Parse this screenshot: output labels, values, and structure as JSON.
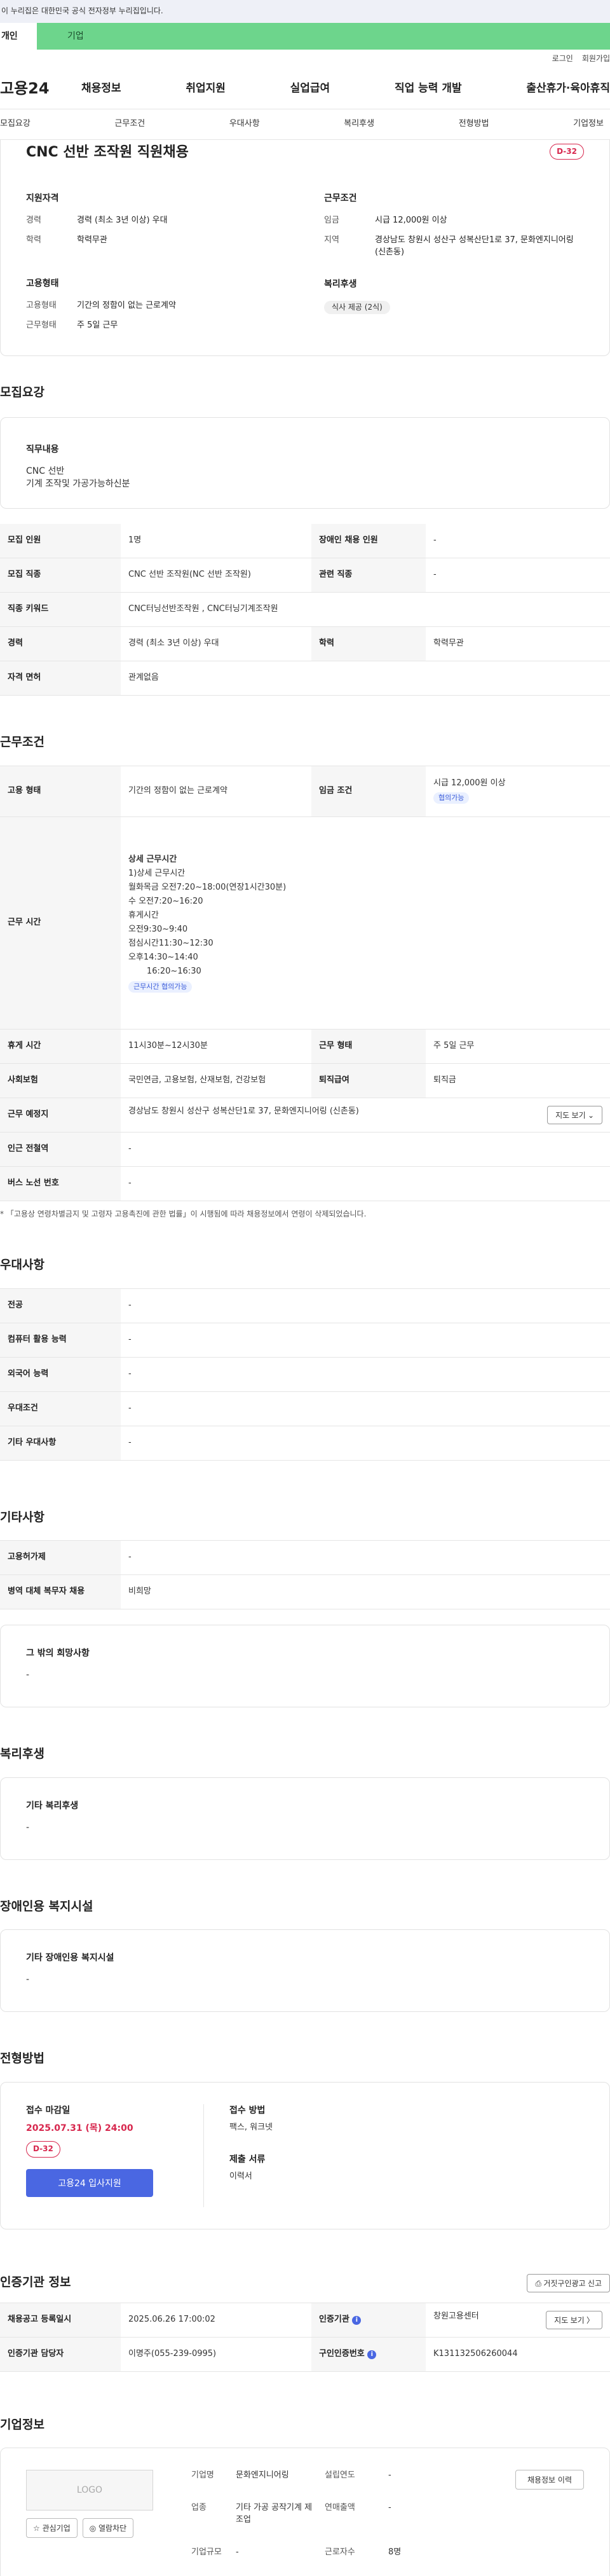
{
  "gov_banner": "이 누리집은 대한민국 공식 전자정부 누리집입니다.",
  "svc_tabs": {
    "personal": "개인",
    "corporate": "기업"
  },
  "util": {
    "login": "로그인",
    "join": "회원가입"
  },
  "logo": "고용24",
  "nav": [
    "채용정보",
    "취업지원",
    "실업급여",
    "직업 능력 개발",
    "출산휴가·육아휴직"
  ],
  "sub_tabs": [
    "모집요강",
    "근무조건",
    "우대사항",
    "복리후생",
    "전형방법",
    "기업정보"
  ],
  "summary": {
    "title": "CNC 선반 조작원 직원채용",
    "dday": "D-32",
    "qual_title": "지원자격",
    "career_k": "경력",
    "career_v": "경력 (최소 3년 이상) 우대",
    "edu_k": "학력",
    "edu_v": "학력무관",
    "emp_title": "고용형태",
    "emptype_k": "고용형태",
    "emptype_v": "기간의 정함이 없는 근로계약",
    "worktype_k": "근무형태",
    "worktype_v": "주 5일 근무",
    "cond_title": "근무조건",
    "wage_k": "임금",
    "wage_v": "시급 12,000원 이상",
    "area_k": "지역",
    "area_v": "경상남도 창원시 성산구 성복산단1로 37, 문화엔지니어링 (신촌동)",
    "welfare_title": "복리후생",
    "welfare_v": "식사 제공 (2식)"
  },
  "recruit": {
    "title": "모집요강",
    "duty_h": "직무내용",
    "duty_1": "CNC 선반",
    "duty_2": "기계 조작및 가공가능하신분",
    "rows": {
      "count_k": "모집 인원",
      "count_v": "1명",
      "disabled_k": "장애인 채용 인원",
      "disabled_v": "-",
      "job_k": "모집 직종",
      "job_v": "CNC 선반 조작원(NC 선반 조작원)",
      "related_k": "관련 직종",
      "related_v": "-",
      "kw_k": "직종 키워드",
      "kw_v": "CNC터닝선반조작원 , CNC터닝기계조작원",
      "career_k": "경력",
      "career_v": "경력 (최소 3년 이상) 우대",
      "edu_k": "학력",
      "edu_v": "학력무관",
      "license_k": "자격 면허",
      "license_v": "관계없음"
    }
  },
  "work": {
    "title": "근무조건",
    "emptype_k": "고용 형태",
    "emptype_v": "기간의 정함이 없는 근로계약",
    "wage_k": "임금 조건",
    "wage_v": "시급 12,000원 이상",
    "wage_chip": "협의가능",
    "hours_k": "근무 시간",
    "hours_lines": [
      "상세 근무시간",
      "1)상세 근무시간",
      "월화목금 오전7:20~18:00(연장1시간30분)",
      "수 오전7:20~16:20",
      "휴게시간",
      "오전9:30~9:40",
      "점심시간11:30~12:30",
      "오후14:30~14:40",
      "       16:20~16:30"
    ],
    "hours_chip": "근무시간 협의가능",
    "break_k": "휴게 시간",
    "break_v": "11시30분~12시30분",
    "form_k": "근무 형태",
    "form_v": "주 5일 근무",
    "insure_k": "사회보험",
    "insure_v": "국민연금, 고용보험, 산재보험, 건강보험",
    "retire_k": "퇴직급여",
    "retire_v": "퇴직금",
    "place_k": "근무 예정지",
    "place_v": "경상남도 창원시 성산구 성복산단1로 37, 문화엔지니어링 (신촌동)",
    "map_btn": "지도 보기 ⌄",
    "subway_k": "인근 전철역",
    "subway_v": "-",
    "bus_k": "버스 노선 번호",
    "bus_v": "-",
    "note": "* 「고용상 연령차별금지 및 고령자 고용촉진에 관한 법률」이 시행됨에 따라 채용정보에서 연령이 삭제되었습니다."
  },
  "pref": {
    "title": "우대사항",
    "major_k": "전공",
    "major_v": "-",
    "pc_k": "컴퓨터 활용 능력",
    "pc_v": "-",
    "lang_k": "외국어 능력",
    "lang_v": "-",
    "cond_k": "우대조건",
    "cond_v": "-",
    "etc_k": "기타 우대사항",
    "etc_v": "-"
  },
  "other": {
    "title": "기타사항",
    "permit_k": "고용허가제",
    "permit_v": "-",
    "mil_k": "병역 대체 복무자 채용",
    "mil_v": "비희망",
    "wish_h": "그 밖의 희망사항",
    "wish_v": "-"
  },
  "welfare": {
    "title": "복리후생",
    "h": "기타 복리후생",
    "v": "-"
  },
  "disabled": {
    "title": "장애인용 복지시설",
    "h": "기타 장애인용 복지시설",
    "v": "-"
  },
  "process": {
    "title": "전형방법",
    "deadline_h": "접수 마감일",
    "deadline_v": "2025.07.31 (목) 24:00",
    "dday": "D-32",
    "apply_btn": "고용24 입사지원",
    "method_h": "접수 방법",
    "method_v": "팩스, 워크넷",
    "docs_h": "제출 서류",
    "docs_v": "이력서"
  },
  "cert": {
    "title": "인증기관 정보",
    "report_btn": "거짓구인광고 신고",
    "date_k": "채용공고 등록일시",
    "date_v": "2025.06.26 17:00:02",
    "org_k": "인증기관",
    "org_v": "창원고용센터",
    "map_btn": "지도 보기 〉",
    "mgr_k": "인증기관 담당자",
    "mgr_v": "이명주(055-239-0995)",
    "no_k": "구인인증번호",
    "no_v": "K131132506260044"
  },
  "company": {
    "title": "기업정보",
    "logo": "LOGO",
    "fav_btn": "☆ 관심기업",
    "block_btn": "◎ 열람차단",
    "list_btn": "채용정보 이력",
    "name_k": "기업명",
    "name_v": "문화엔지니어링",
    "year_k": "설립연도",
    "year_v": "-",
    "ind_k": "업종",
    "ind_v": "기타 가공 공작기계 제조업",
    "sales_k": "연매출액",
    "sales_v": "-",
    "emp_k": "근로자수",
    "emp_v": "8명",
    "size_k": "기업규모",
    "size_v": "-"
  },
  "icons": [
    "info-icon"
  ]
}
